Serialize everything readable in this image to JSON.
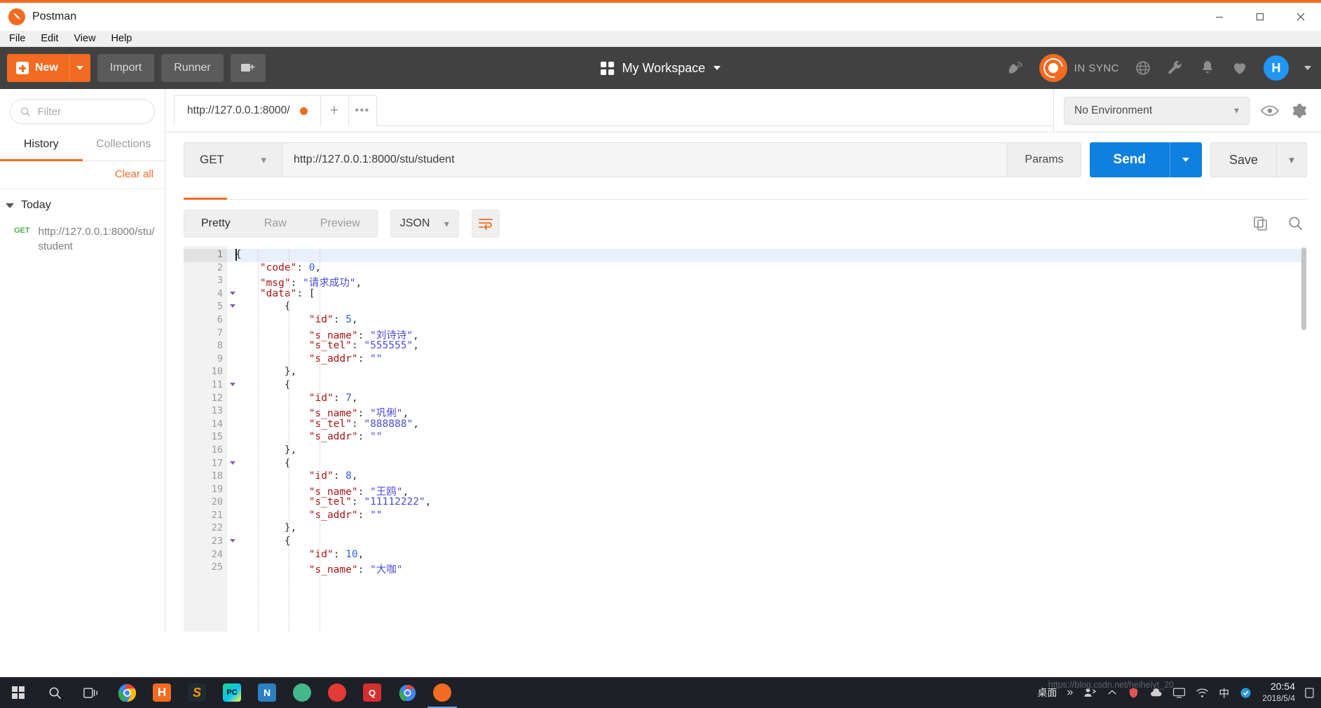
{
  "window": {
    "app_title": "Postman",
    "minimize": "—",
    "maximize": "□",
    "close": "✕"
  },
  "menubar": [
    "File",
    "Edit",
    "View",
    "Help"
  ],
  "toolbar": {
    "new_label": "New",
    "import_label": "Import",
    "runner_label": "Runner",
    "workspace_label": "My Workspace",
    "sync_label": "IN SYNC",
    "avatar_initial": "H"
  },
  "sidebar": {
    "filter_placeholder": "Filter",
    "tabs": [
      {
        "label": "History",
        "active": true
      },
      {
        "label": "Collections",
        "active": false
      }
    ],
    "clear_all": "Clear all",
    "group_label": "Today",
    "history": [
      {
        "method": "GET",
        "url": "http://127.0.0.1:8000/stu/student"
      }
    ]
  },
  "request": {
    "tab_label": "http://127.0.0.1:8000/",
    "new_tab": "+",
    "more_tab": "•••",
    "environment": "No Environment",
    "method": "GET",
    "url": "http://127.0.0.1:8000/stu/student",
    "params_label": "Params",
    "send_label": "Send",
    "save_label": "Save"
  },
  "response": {
    "view_tabs": [
      {
        "label": "Pretty",
        "active": true
      },
      {
        "label": "Raw",
        "active": false
      },
      {
        "label": "Preview",
        "active": false
      }
    ],
    "format": "JSON",
    "body_lines": [
      {
        "n": 1,
        "fold": true,
        "segments": [
          {
            "t": "{",
            "c": "p"
          }
        ]
      },
      {
        "n": 2,
        "fold": false,
        "segments": [
          {
            "t": "    \"code\"",
            "c": "k"
          },
          {
            "t": ": ",
            "c": "p"
          },
          {
            "t": "0",
            "c": "n"
          },
          {
            "t": ",",
            "c": "p"
          }
        ]
      },
      {
        "n": 3,
        "fold": false,
        "segments": [
          {
            "t": "    \"msg\"",
            "c": "k"
          },
          {
            "t": ": ",
            "c": "p"
          },
          {
            "t": "\"请求成功\"",
            "c": "s"
          },
          {
            "t": ",",
            "c": "p"
          }
        ]
      },
      {
        "n": 4,
        "fold": true,
        "segments": [
          {
            "t": "    \"data\"",
            "c": "k"
          },
          {
            "t": ": [",
            "c": "p"
          }
        ]
      },
      {
        "n": 5,
        "fold": true,
        "segments": [
          {
            "t": "        {",
            "c": "p"
          }
        ]
      },
      {
        "n": 6,
        "fold": false,
        "segments": [
          {
            "t": "            \"id\"",
            "c": "k"
          },
          {
            "t": ": ",
            "c": "p"
          },
          {
            "t": "5",
            "c": "n"
          },
          {
            "t": ",",
            "c": "p"
          }
        ]
      },
      {
        "n": 7,
        "fold": false,
        "segments": [
          {
            "t": "            \"s_name\"",
            "c": "k"
          },
          {
            "t": ": ",
            "c": "p"
          },
          {
            "t": "\"刘诗诗\"",
            "c": "s"
          },
          {
            "t": ",",
            "c": "p"
          }
        ]
      },
      {
        "n": 8,
        "fold": false,
        "segments": [
          {
            "t": "            \"s_tel\"",
            "c": "k"
          },
          {
            "t": ": ",
            "c": "p"
          },
          {
            "t": "\"555555\"",
            "c": "s"
          },
          {
            "t": ",",
            "c": "p"
          }
        ]
      },
      {
        "n": 9,
        "fold": false,
        "segments": [
          {
            "t": "            \"s_addr\"",
            "c": "k"
          },
          {
            "t": ": ",
            "c": "p"
          },
          {
            "t": "\"\"",
            "c": "s"
          }
        ]
      },
      {
        "n": 10,
        "fold": false,
        "segments": [
          {
            "t": "        },",
            "c": "p"
          }
        ]
      },
      {
        "n": 11,
        "fold": true,
        "segments": [
          {
            "t": "        {",
            "c": "p"
          }
        ]
      },
      {
        "n": 12,
        "fold": false,
        "segments": [
          {
            "t": "            \"id\"",
            "c": "k"
          },
          {
            "t": ": ",
            "c": "p"
          },
          {
            "t": "7",
            "c": "n"
          },
          {
            "t": ",",
            "c": "p"
          }
        ]
      },
      {
        "n": 13,
        "fold": false,
        "segments": [
          {
            "t": "            \"s_name\"",
            "c": "k"
          },
          {
            "t": ": ",
            "c": "p"
          },
          {
            "t": "\"巩俐\"",
            "c": "s"
          },
          {
            "t": ",",
            "c": "p"
          }
        ]
      },
      {
        "n": 14,
        "fold": false,
        "segments": [
          {
            "t": "            \"s_tel\"",
            "c": "k"
          },
          {
            "t": ": ",
            "c": "p"
          },
          {
            "t": "\"888888\"",
            "c": "s"
          },
          {
            "t": ",",
            "c": "p"
          }
        ]
      },
      {
        "n": 15,
        "fold": false,
        "segments": [
          {
            "t": "            \"s_addr\"",
            "c": "k"
          },
          {
            "t": ": ",
            "c": "p"
          },
          {
            "t": "\"\"",
            "c": "s"
          }
        ]
      },
      {
        "n": 16,
        "fold": false,
        "segments": [
          {
            "t": "        },",
            "c": "p"
          }
        ]
      },
      {
        "n": 17,
        "fold": true,
        "segments": [
          {
            "t": "        {",
            "c": "p"
          }
        ]
      },
      {
        "n": 18,
        "fold": false,
        "segments": [
          {
            "t": "            \"id\"",
            "c": "k"
          },
          {
            "t": ": ",
            "c": "p"
          },
          {
            "t": "8",
            "c": "n"
          },
          {
            "t": ",",
            "c": "p"
          }
        ]
      },
      {
        "n": 19,
        "fold": false,
        "segments": [
          {
            "t": "            \"s_name\"",
            "c": "k"
          },
          {
            "t": ": ",
            "c": "p"
          },
          {
            "t": "\"王鸥\"",
            "c": "s"
          },
          {
            "t": ",",
            "c": "p"
          }
        ]
      },
      {
        "n": 20,
        "fold": false,
        "segments": [
          {
            "t": "            \"s_tel\"",
            "c": "k"
          },
          {
            "t": ": ",
            "c": "p"
          },
          {
            "t": "\"11112222\"",
            "c": "s"
          },
          {
            "t": ",",
            "c": "p"
          }
        ]
      },
      {
        "n": 21,
        "fold": false,
        "segments": [
          {
            "t": "            \"s_addr\"",
            "c": "k"
          },
          {
            "t": ": ",
            "c": "p"
          },
          {
            "t": "\"\"",
            "c": "s"
          }
        ]
      },
      {
        "n": 22,
        "fold": false,
        "segments": [
          {
            "t": "        },",
            "c": "p"
          }
        ]
      },
      {
        "n": 23,
        "fold": true,
        "segments": [
          {
            "t": "        {",
            "c": "p"
          }
        ]
      },
      {
        "n": 24,
        "fold": false,
        "segments": [
          {
            "t": "            \"id\"",
            "c": "k"
          },
          {
            "t": ": ",
            "c": "p"
          },
          {
            "t": "10",
            "c": "n"
          },
          {
            "t": ",",
            "c": "p"
          }
        ]
      },
      {
        "n": 25,
        "fold": false,
        "segments": [
          {
            "t": "            \"s_name\"",
            "c": "k"
          },
          {
            "t": ": ",
            "c": "p"
          },
          {
            "t": "\"大咖\"",
            "c": "s"
          }
        ]
      }
    ]
  },
  "taskbar": {
    "desktop_label": "桌面",
    "overflow": "»",
    "time": "20:54",
    "date": "2018/5/4",
    "ime": "中",
    "watermark": "https://blog.csdn.net/heiheiyt_20"
  },
  "colors": {
    "accent_orange": "#f26b21",
    "send_blue": "#0f7fe0",
    "toolbar_dark": "#414141",
    "get_green": "#4caf50",
    "avatar_blue": "#2196f3"
  }
}
